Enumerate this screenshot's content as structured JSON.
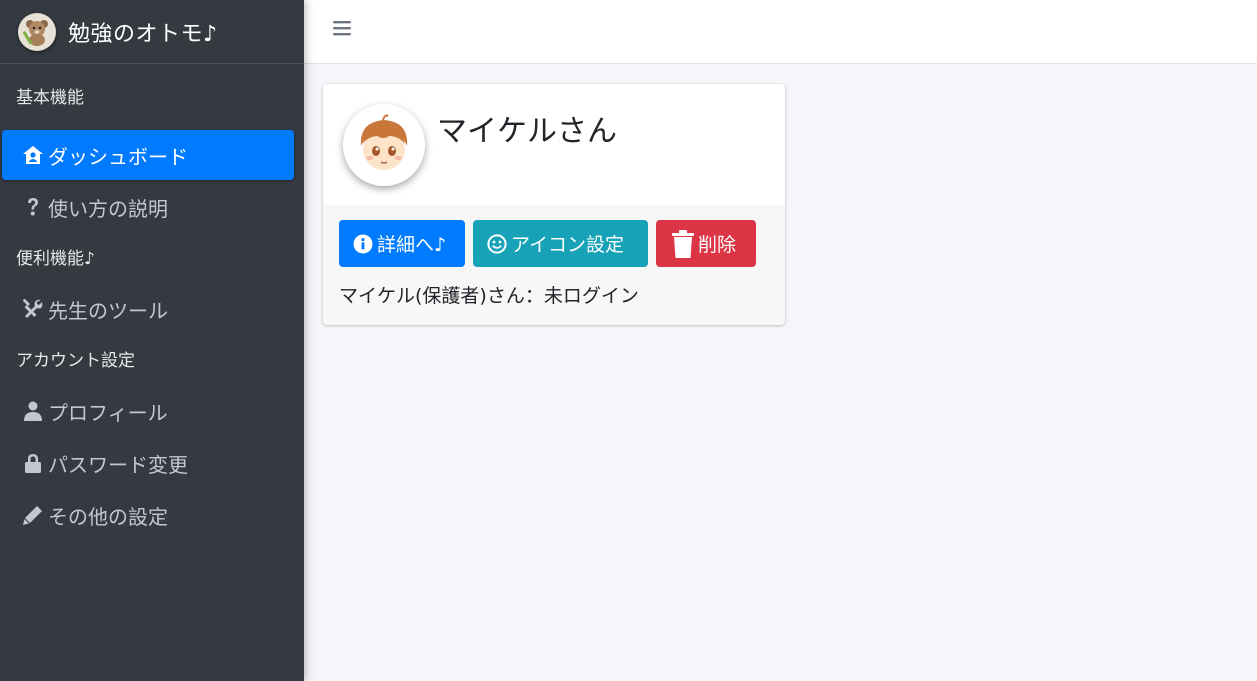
{
  "brand": {
    "title": "勉強のオトモ♪"
  },
  "sidebar": {
    "sections": [
      {
        "header": "基本機能"
      },
      {
        "header": "便利機能♪"
      },
      {
        "header": "アカウント設定"
      }
    ],
    "items": [
      {
        "label": "ダッシュボード",
        "icon": "house-user-icon",
        "active": true
      },
      {
        "label": "使い方の説明",
        "icon": "question-icon"
      },
      {
        "label": "先生のツール",
        "icon": "tools-icon"
      },
      {
        "label": "プロフィール",
        "icon": "user-icon"
      },
      {
        "label": "パスワード変更",
        "icon": "lock-icon"
      },
      {
        "label": "その他の設定",
        "icon": "pencil-icon"
      }
    ]
  },
  "topbar": {
    "menu_icon": "hamburger-icon"
  },
  "card": {
    "name": "マイケルさん",
    "buttons": {
      "detail": "詳細へ♪",
      "icon_setting": "アイコン設定",
      "delete": "削除"
    },
    "status": "マイケル(保護者)さん：未ログイン"
  },
  "colors": {
    "sidebar_bg": "#343a40",
    "primary": "#007bff",
    "info": "#17a2b8",
    "danger": "#dc3545"
  }
}
